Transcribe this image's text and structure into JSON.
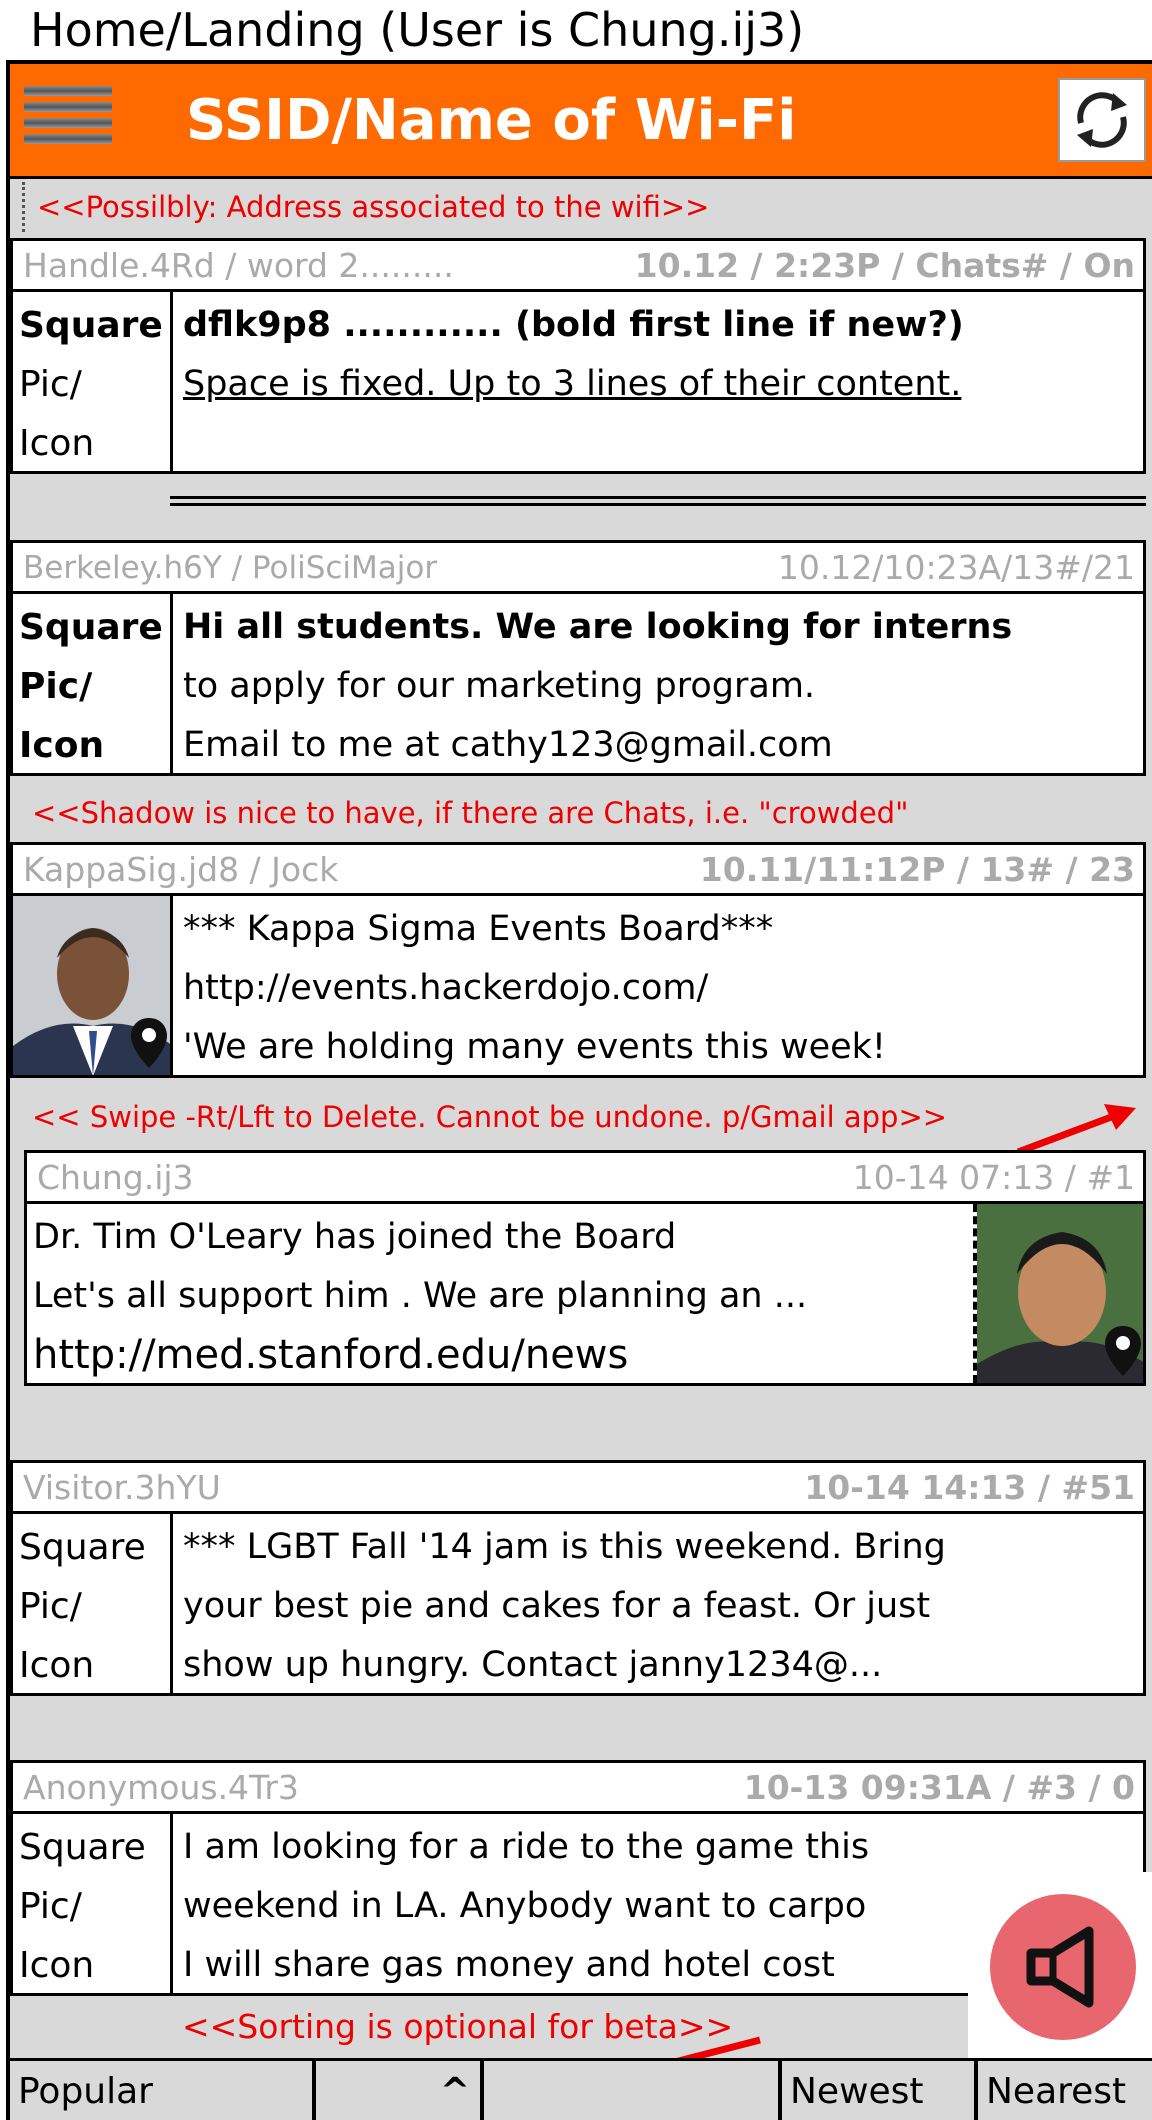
{
  "page_title": "Home/Landing (User is Chung.ij3)",
  "appbar": {
    "title": "SSID/Name of Wi-Fi",
    "menu_icon": "hamburger-menu-icon",
    "refresh_icon": "refresh-icon",
    "accent_color": "#ff6a00"
  },
  "address_note": "<<Possilbly: Address associated to the wifi>>",
  "posts": [
    {
      "handle": "Handle.4Rd / word 2.........",
      "meta": "10.12 / 2:23P / Chats# / On",
      "pic_label": [
        "Square",
        "Pic/",
        "Icon"
      ],
      "lines": [
        "dflk9p8 ............ (bold first line if new?)",
        "Space is fixed. Up to 3 lines of their content."
      ]
    },
    {
      "handle": "Berkeley.h6Y / PoliSciMajor",
      "meta": "10.12/10:23A/13#/21",
      "pic_label": [
        "Square",
        "Pic/",
        "Icon"
      ],
      "lines": [
        "Hi all students. We are looking for interns",
        "to apply for our marketing program.",
        "Email to me at cathy123@gmail.com"
      ]
    },
    {
      "handle": "KappaSig.jd8 / Jock",
      "meta": "10.11/11:12P / 13# / 23",
      "lines": [
        "*** Kappa Sigma Events Board***",
        "http://events.hackerdojo.com/",
        "'We are holding many events this week!"
      ]
    },
    {
      "handle": "Chung.ij3",
      "meta": "10-14 07:13 / #1",
      "lines": [
        "Dr. Tim O'Leary has joined the  Board",
        "Let's all support him . We are planning an ...",
        "http://med.stanford.edu/news"
      ]
    },
    {
      "handle": "Visitor.3hYU",
      "meta": "10-14 14:13 / #51",
      "pic_label": [
        "Square",
        "Pic/",
        "Icon"
      ],
      "lines": [
        "*** LGBT Fall '14 jam is this weekend. Bring",
        "your best pie and cakes for a feast. Or just",
        "show up hungry. Contact janny1234@..."
      ]
    },
    {
      "handle": "Anonymous.4Tr3",
      "meta": "10-13 09:31A / #3 / 0",
      "pic_label": [
        "Square",
        "Pic/",
        "Icon"
      ],
      "lines": [
        "I am looking for a ride to the game this",
        "weekend in LA. Anybody want to carpo",
        "I will share gas money and hotel cost"
      ]
    }
  ],
  "notes": {
    "shadow": "<<Shadow is nice to have, if there are Chats, i.e. \"crowded\"",
    "swipe": "<< Swipe -Rt/Lft to Delete. Cannot be undone. p/Gmail app>>",
    "sorting": "<<Sorting is optional for beta>>"
  },
  "tabs": [
    "Popular",
    "^",
    "",
    "Newest",
    "Nearest"
  ],
  "fab_icon": "megaphone-icon",
  "annotation_color": "#e00000"
}
